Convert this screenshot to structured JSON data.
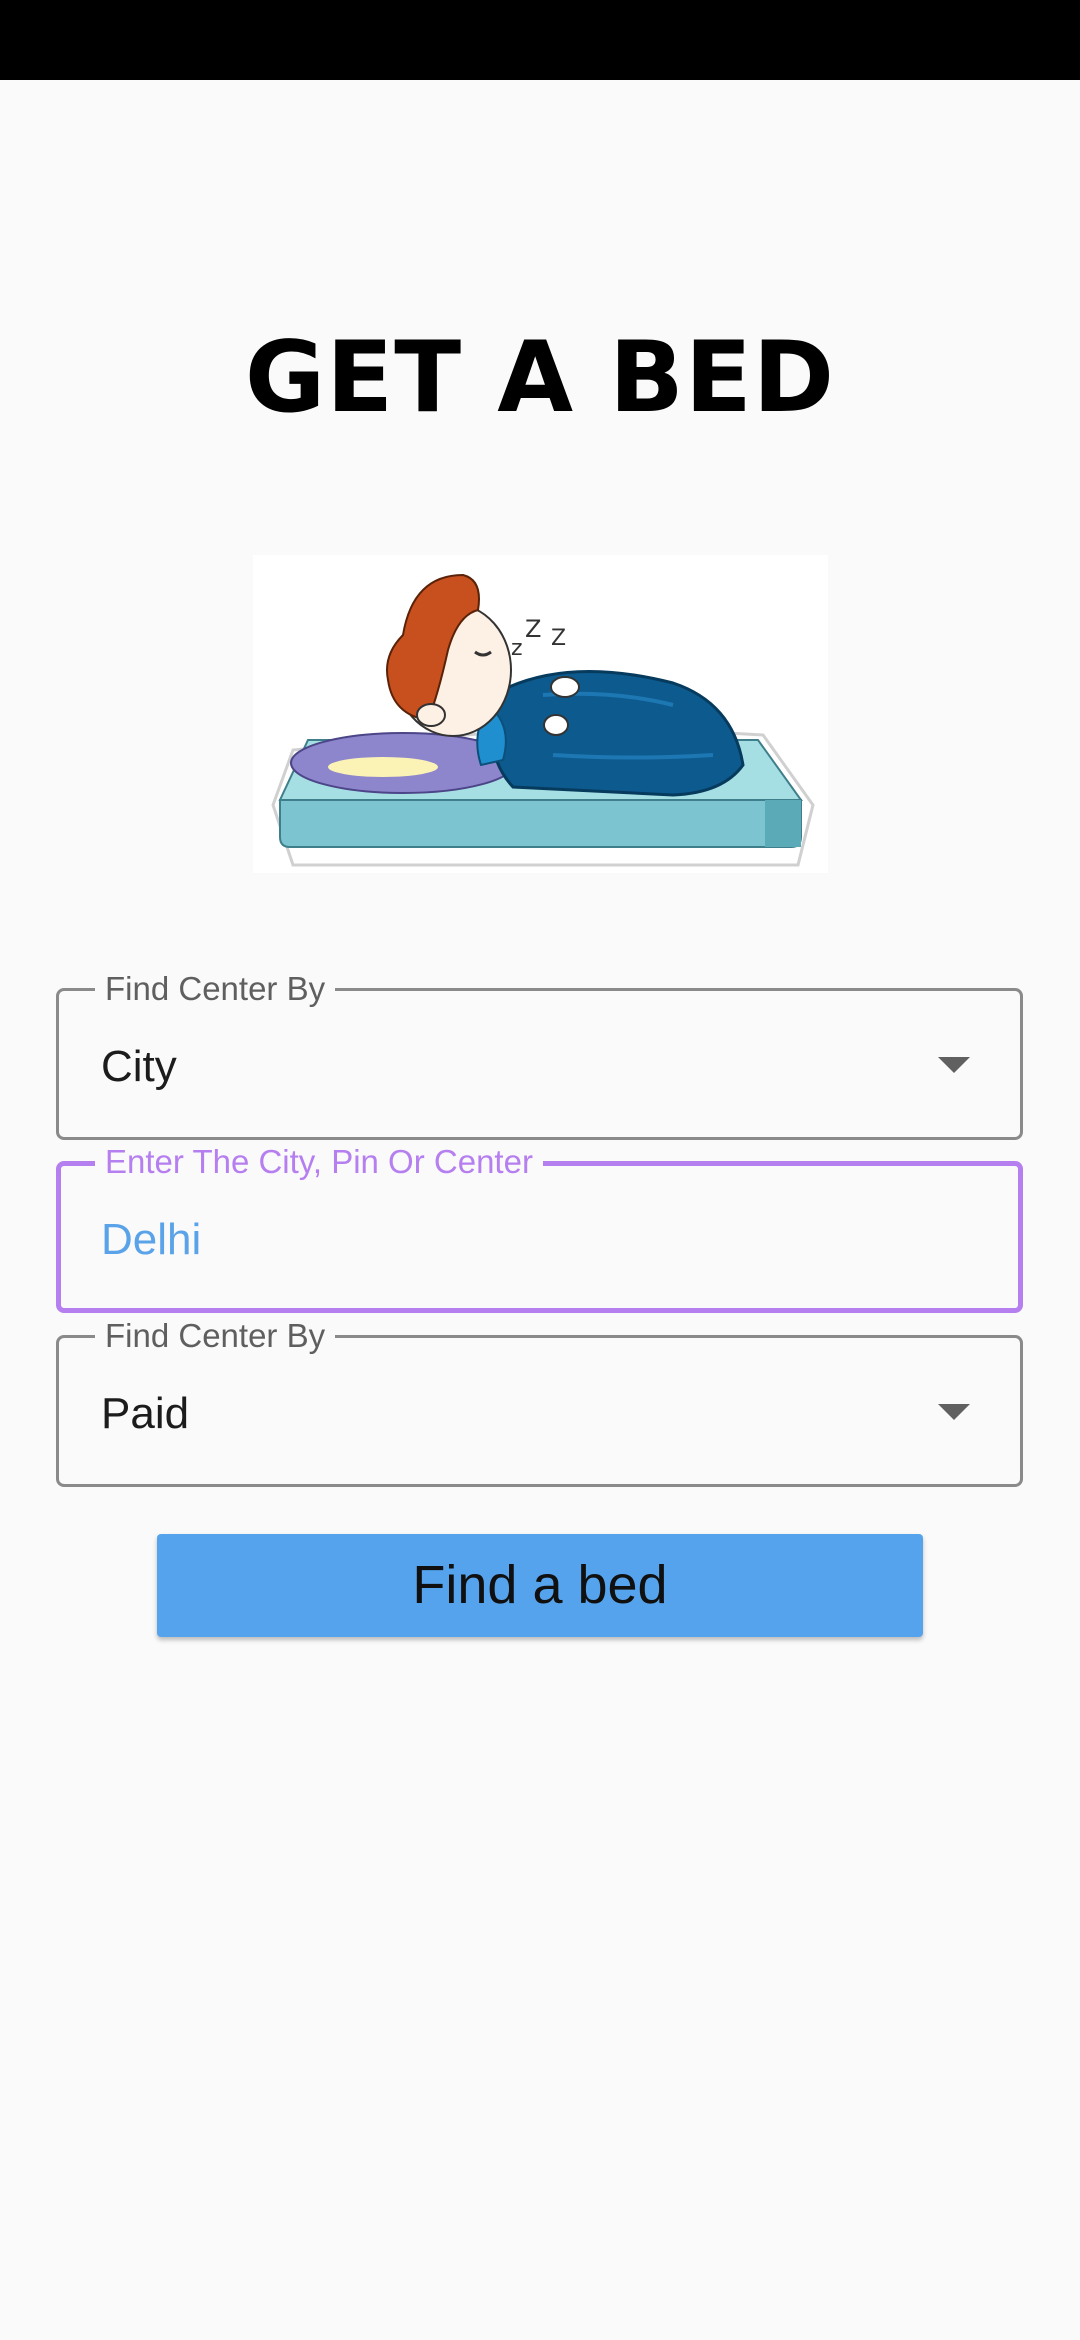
{
  "page": {
    "title": "GET A BED"
  },
  "form": {
    "search_by": {
      "label": "Find Center By",
      "value": "City"
    },
    "location": {
      "label": "Enter The City, Pin Or Center",
      "value": "Delhi"
    },
    "type": {
      "label": "Find Center By",
      "value": "Paid"
    },
    "submit_label": "Find a bed"
  },
  "colors": {
    "status_bar": "#000000",
    "background": "#fafafa",
    "accent_focus": "#b67ff0",
    "input_value": "#5aa3e8",
    "button": "#55a3ed"
  },
  "illustration": {
    "icon": "sleeping-boy-in-bed-illustration"
  }
}
